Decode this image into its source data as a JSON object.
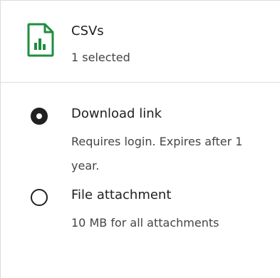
{
  "file": {
    "icon": "spreadsheet-file-icon",
    "title": "CSVs",
    "subtitle": "1 selected",
    "icon_color": "#1e8e3e"
  },
  "options": [
    {
      "label": "Download link",
      "description": "Requires login. Expires after 1 year.",
      "selected": true
    },
    {
      "label": "File attachment",
      "description": "10 MB for all attachments",
      "selected": false
    }
  ]
}
